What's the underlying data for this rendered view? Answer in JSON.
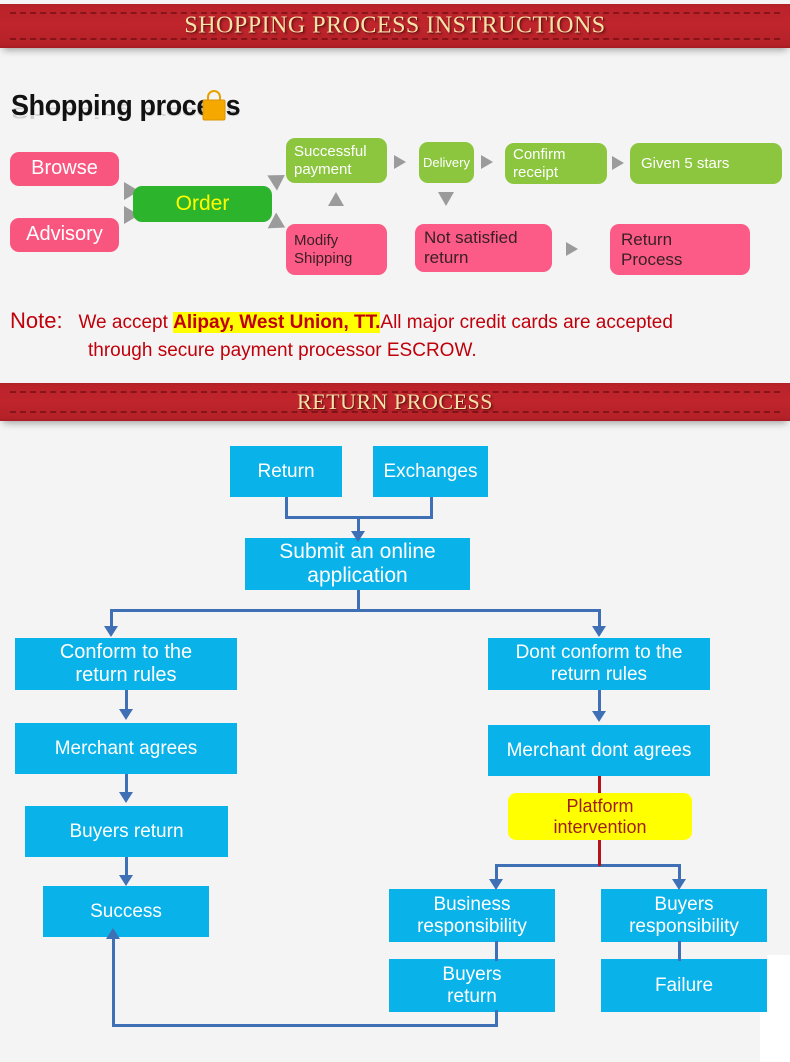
{
  "banner1": {
    "title": "SHOPPING PROCESS INSTRUCTIONS"
  },
  "banner2": {
    "title": "RETURN PROCESS"
  },
  "shopping_heading": {
    "text": "Shopping process",
    "icon": "shopping-bag-icon"
  },
  "shopping_flow": {
    "nodes": [
      {
        "id": "browse",
        "label": "Browse",
        "color": "#f9567f",
        "text_color": "#ffffff"
      },
      {
        "id": "advisory",
        "label": "Advisory",
        "color": "#f9567f",
        "text_color": "#ffffff"
      },
      {
        "id": "order",
        "label": "Order",
        "color": "#2db42d",
        "text_color": "#ffff00"
      },
      {
        "id": "successful_payment",
        "label": "Successful\npayment",
        "line1": "Successful",
        "line2": "payment",
        "color": "#8cc63f",
        "text_color": "#ffffff"
      },
      {
        "id": "modify_shipping",
        "label": "Modify Shipping",
        "line1": "Modify",
        "line2": "Shipping",
        "color": "#fb5b86",
        "text_color": "#3a2026"
      },
      {
        "id": "delivery",
        "label": "Delivery",
        "color": "#8cc63f",
        "text_color": "#ffffff"
      },
      {
        "id": "confirm_receipt",
        "label": "Confirm receipt",
        "line1": "Confirm",
        "line2": "receipt",
        "color": "#8cc63f",
        "text_color": "#ffffff"
      },
      {
        "id": "given_5_stars",
        "label": "Given 5 stars",
        "color": "#8cc63f",
        "text_color": "#ffffff"
      },
      {
        "id": "not_satisfied_return",
        "label": "Not satisfied return",
        "line1": "Not satisfied",
        "line2": "return",
        "color": "#fb5b86",
        "text_color": "#3a2026"
      },
      {
        "id": "return_process",
        "label": "Return Process",
        "line1": "Return",
        "line2": "Process",
        "color": "#fb5b86",
        "text_color": "#3a2026"
      }
    ]
  },
  "note": {
    "label": "Note:",
    "text_before": "We accept",
    "highlight": "Alipay, West Union, TT.",
    "text_after": "All major credit cards are accepted",
    "line2": "through secure payment processor ESCROW.",
    "highlight_color": "#ffff00",
    "text_color": "#c0000b"
  },
  "return_flow": {
    "nodes": [
      {
        "id": "return",
        "label": "Return"
      },
      {
        "id": "exchanges",
        "label": "Exchanges"
      },
      {
        "id": "submit_application",
        "line1": "Submit an online",
        "line2": "application"
      },
      {
        "id": "conform",
        "line1": "Conform to the",
        "line2": "return rules"
      },
      {
        "id": "dont_conform",
        "line1": "Dont conform to the",
        "line2": "return rules"
      },
      {
        "id": "merchant_agrees",
        "label": "Merchant agrees"
      },
      {
        "id": "merchant_dont_agrees",
        "label": "Merchant dont agrees"
      },
      {
        "id": "buyers_return_left",
        "label": "Buyers return"
      },
      {
        "id": "platform_intervention",
        "line1": "Platform",
        "line2": "intervention",
        "color": "#ffff00",
        "text_color": "#9d1c1c"
      },
      {
        "id": "success",
        "label": "Success"
      },
      {
        "id": "business_responsibility",
        "line1": "Business",
        "line2": "responsibility"
      },
      {
        "id": "buyers_responsibility",
        "line1": "Buyers",
        "line2": "responsibility"
      },
      {
        "id": "buyers_return_bottom",
        "line1": "Buyers",
        "line2": "return"
      },
      {
        "id": "failure",
        "label": "Failure"
      }
    ],
    "box_color": "#09b2e8",
    "line_color": "#3f6fb5",
    "red_line_color": "#b5121b"
  }
}
